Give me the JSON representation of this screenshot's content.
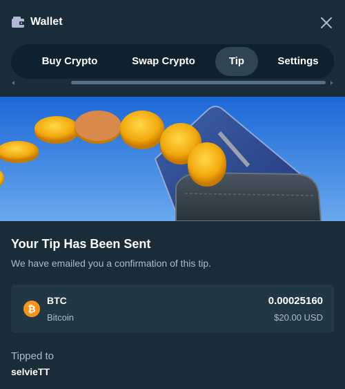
{
  "header": {
    "title": "Wallet",
    "icon": "wallet-icon",
    "close_icon": "close-icon"
  },
  "tabs": [
    {
      "label": "Buy Crypto",
      "active": false
    },
    {
      "label": "Swap Crypto",
      "active": false
    },
    {
      "label": "Tip",
      "active": true
    },
    {
      "label": "Settings",
      "active": false
    }
  ],
  "confirmation": {
    "title": "Your Tip Has Been Sent",
    "subtitle": "We have emailed you a confirmation of this tip."
  },
  "transaction": {
    "coin_icon": "bitcoin-icon",
    "symbol": "BTC",
    "name": "Bitcoin",
    "amount": "0.00025160",
    "fiat_value": "$20.00 USD"
  },
  "recipient": {
    "label": "Tipped to",
    "username": "selvieTT"
  },
  "colors": {
    "background": "#1a2c38",
    "tab_bar": "#0f212e",
    "active_tab": "#2f4553",
    "card": "#213743",
    "muted_text": "#b1bad3",
    "bitcoin_orange": "#f7931a"
  }
}
